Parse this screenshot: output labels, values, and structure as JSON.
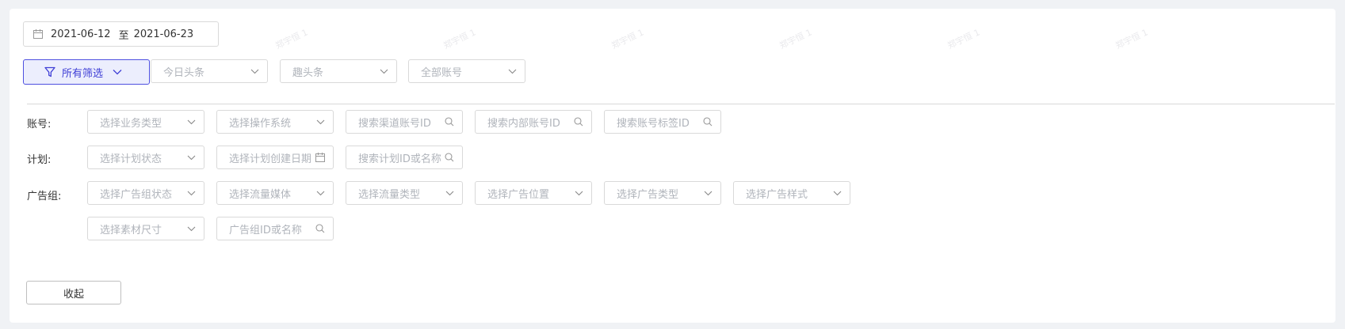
{
  "date_range": {
    "start": "2021-06-12",
    "separator": "至",
    "end": "2021-06-23"
  },
  "filter_button": {
    "label": "所有筛选"
  },
  "top_selects": [
    {
      "placeholder": "今日头条"
    },
    {
      "placeholder": "趣头条"
    },
    {
      "placeholder": "全部账号"
    }
  ],
  "rows": {
    "account": {
      "label": "账号:",
      "fields": [
        {
          "placeholder": "选择业务类型",
          "kind": "select"
        },
        {
          "placeholder": "选择操作系统",
          "kind": "select"
        },
        {
          "placeholder": "搜索渠道账号ID",
          "kind": "search"
        },
        {
          "placeholder": "搜索内部账号ID",
          "kind": "search"
        },
        {
          "placeholder": "搜索账号标签ID",
          "kind": "search"
        }
      ]
    },
    "plan": {
      "label": "计划:",
      "fields": [
        {
          "placeholder": "选择计划状态",
          "kind": "select"
        },
        {
          "placeholder": "选择计划创建日期",
          "kind": "date"
        },
        {
          "placeholder": "搜索计划ID或名称",
          "kind": "search"
        }
      ]
    },
    "adgroup": {
      "label": "广告组:",
      "fields": [
        {
          "placeholder": "选择广告组状态",
          "kind": "select"
        },
        {
          "placeholder": "选择流量媒体",
          "kind": "select"
        },
        {
          "placeholder": "选择流量类型",
          "kind": "select"
        },
        {
          "placeholder": "选择广告位置",
          "kind": "select"
        },
        {
          "placeholder": "选择广告类型",
          "kind": "select"
        },
        {
          "placeholder": "选择广告样式",
          "kind": "select"
        }
      ],
      "fields_row2": [
        {
          "placeholder": "选择素材尺寸",
          "kind": "select"
        },
        {
          "placeholder": "广告组ID或名称",
          "kind": "search"
        }
      ]
    }
  },
  "collapse_button": {
    "label": "收起"
  },
  "watermark": "郑宇恒 1"
}
